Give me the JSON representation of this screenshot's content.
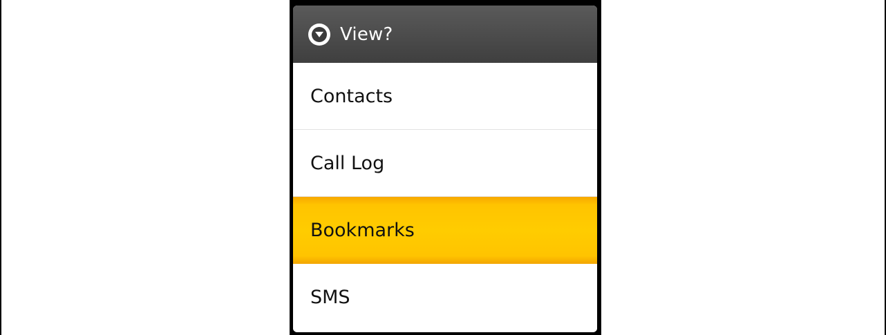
{
  "dialog": {
    "title": "View?",
    "icon": "chevron-down-circle-icon",
    "selected_index": 2,
    "items": [
      {
        "label": "Contacts"
      },
      {
        "label": "Call Log"
      },
      {
        "label": "Bookmarks"
      },
      {
        "label": "SMS"
      }
    ]
  },
  "colors": {
    "header_bg": "#4a4a4a",
    "selected_bg": "#ffc400",
    "text": "#111111"
  }
}
